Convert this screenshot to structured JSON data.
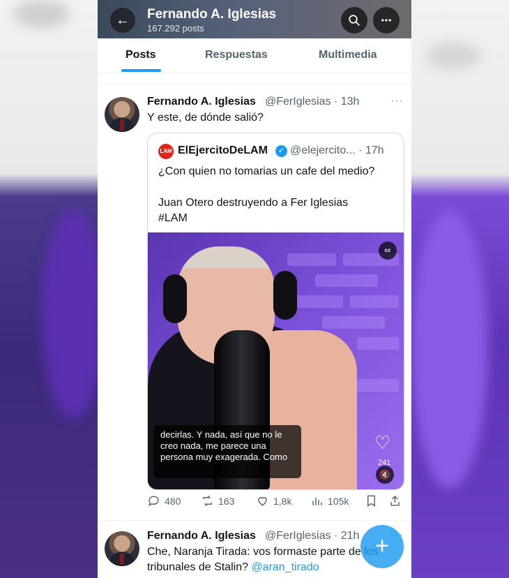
{
  "header": {
    "name": "Fernando A. Iglesias",
    "post_count": "167.292 posts"
  },
  "tabs": [
    {
      "label": "Posts",
      "active": true
    },
    {
      "label": "Respuestas",
      "active": false
    },
    {
      "label": "Multimedia",
      "active": false
    }
  ],
  "icons": {
    "back": "arrow-left-icon",
    "search": "search-icon",
    "more": "more-icon"
  },
  "tweet1": {
    "name": "Fernando A. Iglesias",
    "handle_time": "@FerIglesias · 13h",
    "text": "Y este, de dónde salió?",
    "more": "···",
    "quote": {
      "logo": "LAM",
      "name": "ElEjercitoDeLAM",
      "verified_mark": "✓",
      "handle_time": "@elejercito... · 17h",
      "text_line1": "¿Con quien no tomarias un cafe del medio?",
      "text_line2": "Juan Otero destruyendo a Fer Iglesias",
      "text_line3": "#LAM",
      "video": {
        "cc": "cc",
        "caption": "decirlas. Y nada, así que no le creo nada, me parece una persona muy exagerada. Como",
        "likes": "241"
      }
    },
    "stats": {
      "replies": "480",
      "reposts": "163",
      "likes": "1,8k",
      "views": "105k"
    }
  },
  "tweet2": {
    "name": "Fernando A. Iglesias",
    "handle_time": "@FerIglesias · 21h",
    "text_line1": "Che, Naranja Tirada: vos formaste parte de los",
    "text_line2_prefix": "tribunales de Stalin?",
    "mention": "@aran_tirado",
    "more": "···"
  },
  "colors": {
    "accent": "#1d9bf0",
    "text": "#0f1419",
    "muted": "#536471"
  }
}
